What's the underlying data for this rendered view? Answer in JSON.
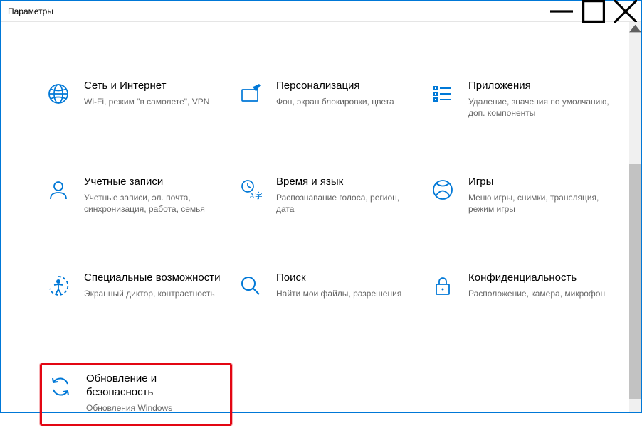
{
  "window": {
    "title": "Параметры"
  },
  "tiles": [
    {
      "title": "Сеть и Интернет",
      "desc": "Wi-Fi, режим \"в самолете\", VPN"
    },
    {
      "title": "Персонализация",
      "desc": "Фон, экран блокировки, цвета"
    },
    {
      "title": "Приложения",
      "desc": "Удаление, значения по умолчанию, доп. компоненты"
    },
    {
      "title": "Учетные записи",
      "desc": "Учетные записи, эл. почта, синхронизация, работа, семья"
    },
    {
      "title": "Время и язык",
      "desc": "Распознавание голоса, регион, дата"
    },
    {
      "title": "Игры",
      "desc": "Меню игры, снимки, трансляция, режим игры"
    },
    {
      "title": "Специальные возможности",
      "desc": "Экранный диктор, контрастность"
    },
    {
      "title": "Поиск",
      "desc": "Найти мои файлы, разрешения"
    },
    {
      "title": "Конфиденциальность",
      "desc": "Расположение, камера, микрофон"
    },
    {
      "title": "Обновление и безопасность",
      "desc": "Обновления Windows"
    }
  ]
}
